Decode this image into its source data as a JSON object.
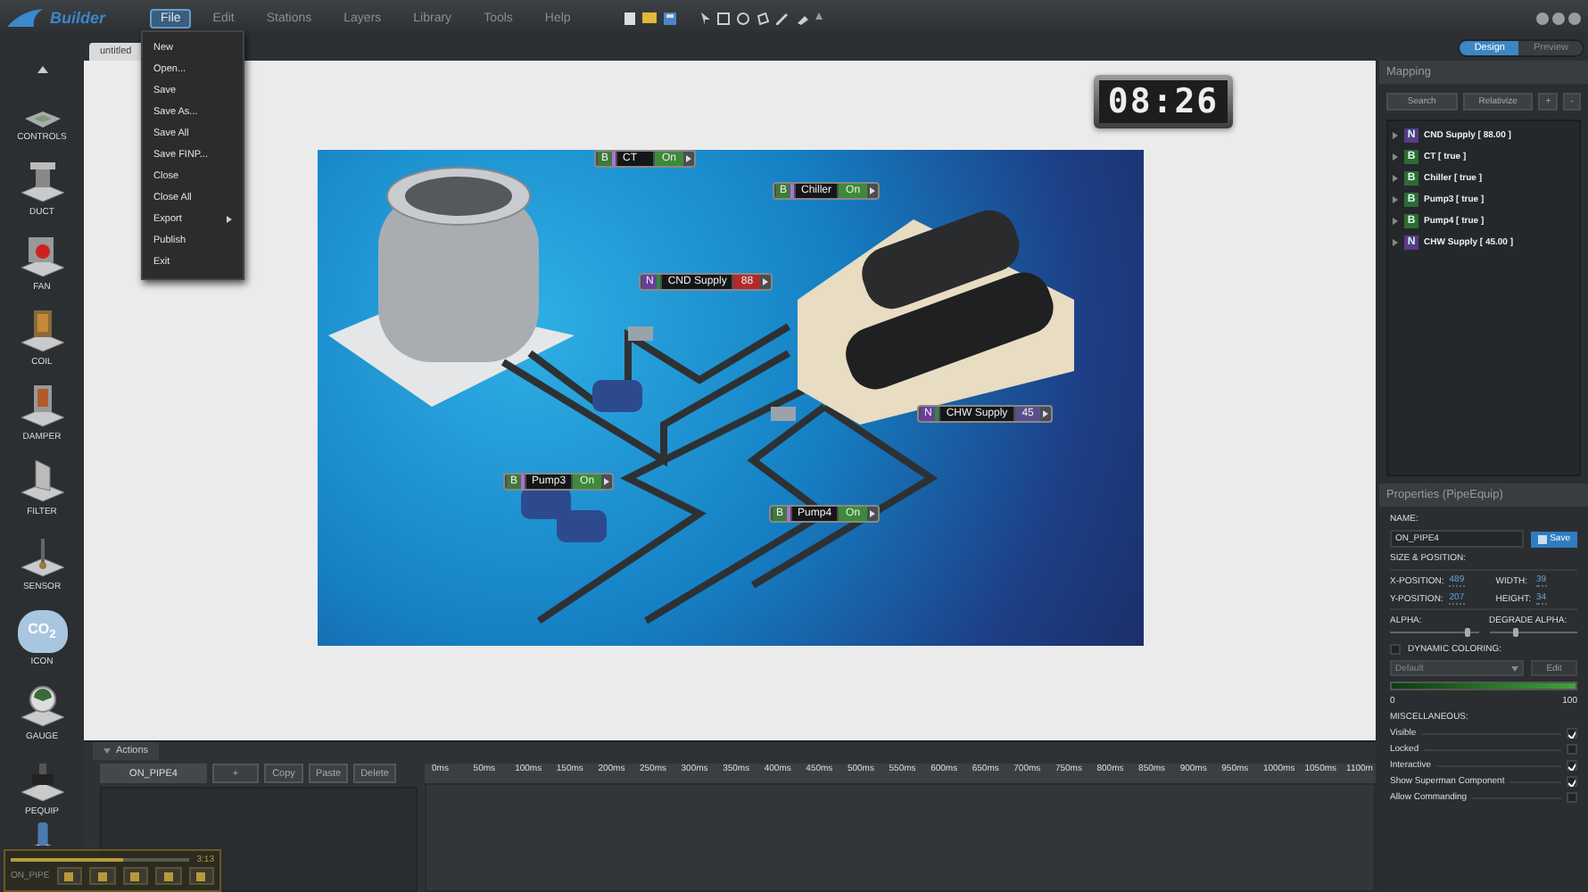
{
  "app": {
    "logo": "Builder"
  },
  "menu": [
    {
      "label": "File",
      "selected": true
    },
    {
      "label": "Edit",
      "selected": false
    },
    {
      "label": "Stations",
      "selected": false
    },
    {
      "label": "Layers",
      "selected": false
    },
    {
      "label": "Library",
      "selected": false
    },
    {
      "label": "Tools",
      "selected": false
    },
    {
      "label": "Help",
      "selected": false
    }
  ],
  "file_menu": [
    {
      "label": "New",
      "submenu": false
    },
    {
      "label": "Open...",
      "submenu": false
    },
    {
      "label": "Save",
      "submenu": false
    },
    {
      "label": "Save As...",
      "submenu": false
    },
    {
      "label": "Save All",
      "submenu": false
    },
    {
      "label": "Save FINP...",
      "submenu": false
    },
    {
      "label": "Close",
      "submenu": false
    },
    {
      "label": "Close All",
      "submenu": false
    },
    {
      "label": "Export",
      "submenu": true
    },
    {
      "label": "Publish",
      "submenu": false
    },
    {
      "label": "Exit",
      "submenu": false
    }
  ],
  "document_tab": {
    "label": "untitled"
  },
  "mode_toggle": [
    {
      "label": "Design",
      "selected": true
    },
    {
      "label": "Preview",
      "selected": false
    }
  ],
  "sidebar": {
    "items": [
      {
        "kind": "controls",
        "label": "CONTROLS"
      },
      {
        "kind": "duct",
        "label": "DUCT"
      },
      {
        "kind": "fan",
        "label": "FAN"
      },
      {
        "kind": "coil",
        "label": "COIL"
      },
      {
        "kind": "damper",
        "label": "DAMPER"
      },
      {
        "kind": "filter",
        "label": "FILTER"
      },
      {
        "kind": "sensor",
        "label": "SENSOR"
      },
      {
        "kind": "co2",
        "label": "ICON",
        "icon_text": "CO$_{2}$"
      },
      {
        "kind": "gauge",
        "label": "GAUGE"
      },
      {
        "kind": "pequip",
        "label": "PEQUIP"
      },
      {
        "kind": "valve"
      }
    ]
  },
  "canvas": {
    "clock": "08:26",
    "tags": [
      {
        "kind": "binary",
        "badge": "B",
        "name": "CT",
        "value": "On",
        "color": "#3d8a3a"
      },
      {
        "kind": "binary",
        "badge": "B",
        "name": "Chiller",
        "value": "On",
        "color": "#3d8a3a"
      },
      {
        "kind": "numeric",
        "badge": "N",
        "name": "CND Supply",
        "value": "88",
        "color": "#b32a2a"
      },
      {
        "kind": "numeric",
        "badge": "N",
        "name": "CHW Supply",
        "value": "45",
        "color": "#5b4f8a"
      },
      {
        "kind": "binary",
        "badge": "B",
        "name": "Pump3",
        "value": "On",
        "color": "#3d8a3a"
      },
      {
        "kind": "binary",
        "badge": "B",
        "name": "Pump4",
        "value": "On",
        "color": "#3d8a3a"
      }
    ]
  },
  "actions": {
    "title": "Actions",
    "expanded": true,
    "name": "ON_PIPE4",
    "buttons": [
      "+",
      "Copy",
      "Paste",
      "Delete"
    ],
    "timeline": [
      "0ms",
      "50ms",
      "100ms",
      "150ms",
      "200ms",
      "250ms",
      "300ms",
      "350ms",
      "400ms",
      "450ms",
      "500ms",
      "550ms",
      "600ms",
      "650ms",
      "700ms",
      "750ms",
      "800ms",
      "850ms",
      "900ms",
      "950ms",
      "1000ms",
      "1050ms",
      "1100m"
    ]
  },
  "player": {
    "label": "ON_PIPE",
    "time": "3:13",
    "level": 0.63
  },
  "mapping": {
    "title": "Mapping",
    "buttons": [
      "Search",
      "Relativize",
      "+",
      "-"
    ],
    "items": [
      {
        "kind": "numeric",
        "badge": "N",
        "label": "CND Supply [ 88.00 ]",
        "expanded": false
      },
      {
        "kind": "binary",
        "badge": "B",
        "label": "CT [ true ]",
        "expanded": false
      },
      {
        "kind": "binary",
        "badge": "B",
        "label": "Chiller [ true ]",
        "expanded": false
      },
      {
        "kind": "binary",
        "badge": "B",
        "label": "Pump3 [ true ]",
        "expanded": false
      },
      {
        "kind": "binary",
        "badge": "B",
        "label": "Pump4 [ true ]",
        "expanded": false
      },
      {
        "kind": "numeric",
        "badge": "N",
        "label": "CHW Supply [ 45.00 ]",
        "expanded": false
      }
    ]
  },
  "properties": {
    "title": "Properties (PipeEquip)",
    "name_label": "NAME:",
    "name": "ON_PIPE4",
    "save": "Save",
    "size_title": "SIZE & POSITION:",
    "fields": [
      {
        "label": "X-POSITION:",
        "value": "489"
      },
      {
        "label": "WIDTH:",
        "value": "39"
      },
      {
        "label": "Y-POSITION:",
        "value": "207"
      },
      {
        "label": "HEIGHT:",
        "value": "34"
      }
    ],
    "sliders": [
      {
        "label": "ALPHA:",
        "level": 0.87
      },
      {
        "label": "DEGRADE ALPHA:",
        "level": 0.3
      }
    ],
    "dynamic_coloring": {
      "label": "DYNAMIC COLORING:",
      "checked": false,
      "preset": "Default",
      "edit": "Edit",
      "edit_disabled": true,
      "min": "0",
      "max": "100"
    },
    "misc_title": "MISCELLANEOUS:",
    "misc": [
      {
        "label": "Visible",
        "checked": true
      },
      {
        "label": "Locked",
        "checked": false
      },
      {
        "label": "Interactive",
        "checked": true
      },
      {
        "label": "Show Superman Component",
        "checked": true
      },
      {
        "label": "Allow Commanding",
        "checked": false
      }
    ]
  }
}
